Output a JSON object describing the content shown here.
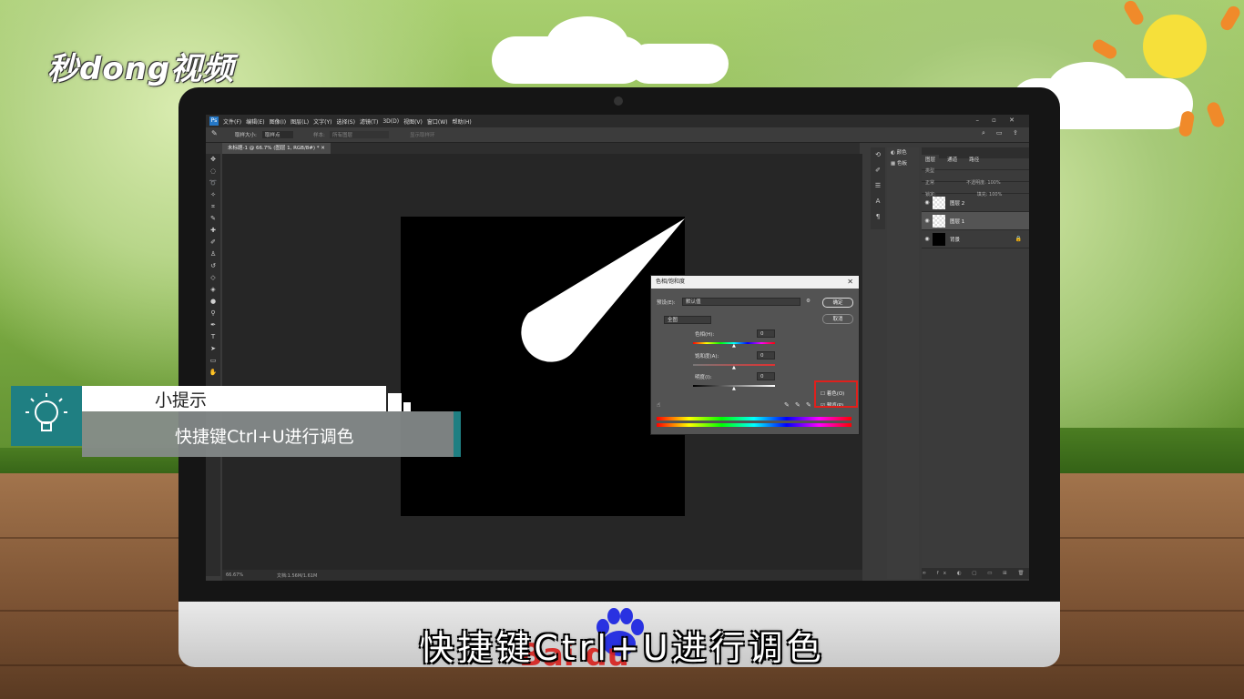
{
  "logo": {
    "text": "秒dong视频"
  },
  "photoshop": {
    "menu": [
      "文件(F)",
      "编辑(E)",
      "图像(I)",
      "图层(L)",
      "文字(Y)",
      "选择(S)",
      "滤镜(T)",
      "3D(D)",
      "视图(V)",
      "窗口(W)",
      "帮助(H)"
    ],
    "options": {
      "sample_size_label": "取样大小:",
      "sample_size_value": "取样点",
      "sample_label": "样本:",
      "sample_value": "所有图层",
      "show_ring": "显示取样环"
    },
    "doc_tab": "未标题-1 @ 66.7% (图层 1, RGB/8#) *",
    "status": {
      "zoom": "66.67%",
      "doc_info": "文档:1.56M/1.61M"
    },
    "panel_small": [
      "颜色",
      "色板"
    ],
    "layers_panel": {
      "tabs": [
        "图层",
        "通道",
        "路径"
      ],
      "kind_label": "类型",
      "blend": "正常",
      "opacity_label": "不透明度: 100%",
      "lock_label": "锁定:",
      "fill_label": "填充: 100%",
      "layers": [
        {
          "name": "图层 2",
          "selected": false
        },
        {
          "name": "图层 1",
          "selected": true
        },
        {
          "name": "背景",
          "selected": false
        }
      ]
    }
  },
  "dialog": {
    "title": "色相/饱和度",
    "preset_label": "预设(E):",
    "preset_value": "默认值",
    "ok": "确定",
    "cancel": "取消",
    "channel": "全图",
    "hue_label": "色相(H):",
    "hue_value": "0",
    "sat_label": "饱和度(A):",
    "sat_value": "0",
    "light_label": "明度(I):",
    "light_value": "0",
    "colorize_label": "着色(O)",
    "preview_label": "预览(P)",
    "colorize_checked": false,
    "preview_checked": true
  },
  "tip": {
    "title": "小提示",
    "text": "快捷键Ctrl+U进行调色"
  },
  "subtitle": "快捷键Ctrl+U进行调色",
  "watermark": "Bai du"
}
